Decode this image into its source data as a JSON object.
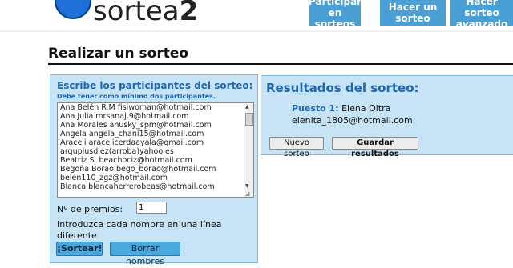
{
  "header": {
    "logo_text": "sortea",
    "logo_number": "2",
    "nav": [
      {
        "label_line1": "Participar en",
        "label_line2": "sorteos"
      },
      {
        "label_line1": "Hacer un",
        "label_line2": "sorteo"
      },
      {
        "label_line1": "Hacer sorteo",
        "label_line2": "avanzado"
      }
    ]
  },
  "page_title": "Realizar un sorteo",
  "participants": {
    "title": "Escribe los participantes del sorteo:",
    "subtitle": "Debe tener como mínimo dos participantes.",
    "lines": [
      "Ana Belén R.M fisiwoman@hotmail.com",
      "Ana Julia mrsanaj.9@hotmail.com",
      "Ana Morales anusky_spm@hotmail.com",
      "Angela angela_chani15@hotmail.com",
      "Araceli aracelicerdaayala@gmail.com",
      "arquplusdiez(arroba)yahoo.es",
      "Beatriz S. beachociz@hotmail.com",
      "Begoña Borao bego_borao@hotmail.com",
      "belen110_zgz@hotmail.com",
      "Blanca blancaherrerobeas@hotmail.com"
    ],
    "premios_label": "Nº de premios:",
    "premios_value": "1",
    "hint": "Introduzca cada nombre en una línea diferente",
    "sortear_button": "¡Sortear!",
    "borrar_button": "Borrar nombres"
  },
  "results": {
    "title": "Resultados del sorteo:",
    "prize_label": "Puesto 1:",
    "winner_name": "Elena Oltra",
    "winner_email": "elenita_1805@hotmail.com",
    "nuevo_button": "Nuevo sorteo",
    "guardar_button": "Guardar resultados"
  }
}
